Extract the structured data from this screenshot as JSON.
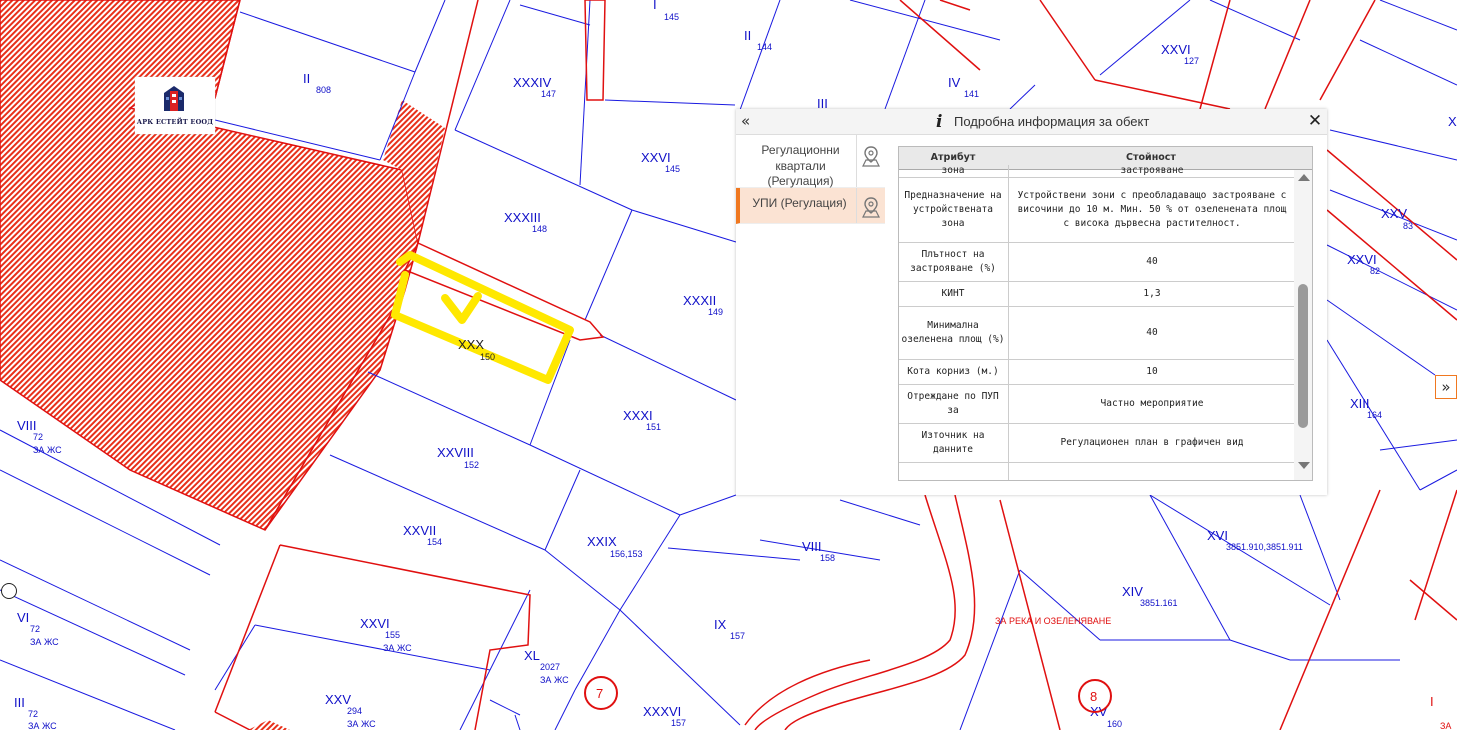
{
  "logo": {
    "text": "АРК ЕСТЕЙТ ЕООД"
  },
  "parcels": [
    {
      "id": "p808",
      "num": "II",
      "sub": "808"
    },
    {
      "id": "p147",
      "num": "XXXIV",
      "sub": "147"
    },
    {
      "id": "p145a",
      "num": "I",
      "sub": "145"
    },
    {
      "id": "p145b",
      "num": "XXVI",
      "sub": "145"
    },
    {
      "id": "p144",
      "num": "II",
      "sub": "144"
    },
    {
      "id": "p141",
      "num": "IV",
      "sub": "141"
    },
    {
      "id": "p127",
      "num": "XXVI",
      "sub": "127"
    },
    {
      "id": "p148",
      "num": "XXXIII",
      "sub": "148"
    },
    {
      "id": "p149",
      "num": "XXXII",
      "sub": "149"
    },
    {
      "id": "p150",
      "num": "XXX",
      "sub": "150"
    },
    {
      "id": "p151",
      "num": "XXXI",
      "sub": "151"
    },
    {
      "id": "p152",
      "num": "XXVIII",
      "sub": "152"
    },
    {
      "id": "p154",
      "num": "XXVII",
      "sub": "154"
    },
    {
      "id": "p156",
      "num": "XXIX",
      "sub": "156,153"
    },
    {
      "id": "p155",
      "num": "XXVI",
      "sub": "155",
      "use": "ЗА ЖС"
    },
    {
      "id": "p294",
      "num": "XXV",
      "sub": "294",
      "use": "ЗА ЖС"
    },
    {
      "id": "p2027",
      "num": "XL",
      "sub": "2027",
      "use": "ЗА ЖС"
    },
    {
      "id": "p157a",
      "num": "IX",
      "sub": "157"
    },
    {
      "id": "p157b",
      "num": "XXXVI",
      "sub": "157"
    },
    {
      "id": "p158",
      "num": "VIII",
      "sub": "158"
    },
    {
      "id": "p72a",
      "num": "VIII",
      "sub": "72",
      "use": "ЗА ЖС"
    },
    {
      "id": "p72b",
      "num": "VI",
      "sub": "72",
      "use": "ЗА ЖС"
    },
    {
      "id": "p72c",
      "num": "III",
      "sub": "72",
      "use": "ЗА ЖС"
    },
    {
      "id": "p83",
      "num": "XXV",
      "sub": "83"
    },
    {
      "id": "p82",
      "num": "XXVI",
      "sub": "82"
    },
    {
      "id": "p164",
      "num": "XIII",
      "sub": "164"
    },
    {
      "id": "p3851a",
      "num": "XVI",
      "sub": "3851.910,3851.911"
    },
    {
      "id": "p3851b",
      "num": "XIV",
      "sub": "3851.161"
    },
    {
      "id": "p160",
      "num": "XV",
      "sub": "160"
    }
  ],
  "partial_labels": {
    "iii_top": "III",
    "x_right": "X",
    "i_bottom_right": "I",
    "za_bottom_right": "ЗА"
  },
  "zone_label": "ЗА РЕКА И ОЗЕЛЕНЯВАНЕ",
  "blocks": [
    "7",
    "8"
  ],
  "panel": {
    "collapse": "«",
    "info_icon": "i",
    "title": "Подробна информация за обект",
    "close": "✕",
    "layers": [
      {
        "label": "Регулационни квартали (Регулация)",
        "active": false
      },
      {
        "label": "УПИ (Регулация)",
        "active": true
      }
    ],
    "table": {
      "header_attr": "Атрибут",
      "header_value": "Стойност",
      "rows": [
        {
          "attr": "зона",
          "value": "застрояване"
        },
        {
          "attr": "Предназначение на устройствената зона",
          "value": "Устройствени зони с преобладаващо застрояване с\nвисочини до 10 м. Мин. 50 % от озеленената площ\nс висока дървесна растителност."
        },
        {
          "attr": "Плътност на застрояване (%)",
          "value": "40"
        },
        {
          "attr": "КИНТ",
          "value": "1,3"
        },
        {
          "attr": "Минимална озеленена площ (%)",
          "value": "40"
        },
        {
          "attr": "Кота корниз (м.)",
          "value": "10"
        },
        {
          "attr": "Отреждане по ПУП за",
          "value": "Частно мероприятие"
        },
        {
          "attr": "Източник на данните",
          "value": "Регулационен план в графичен вид"
        }
      ]
    }
  },
  "expand_button": "»",
  "colors": {
    "parcel_line": "#1a1ae0",
    "regulation_line": "#e01010",
    "highlight": "#ffe800",
    "active_layer": "#f07820"
  }
}
